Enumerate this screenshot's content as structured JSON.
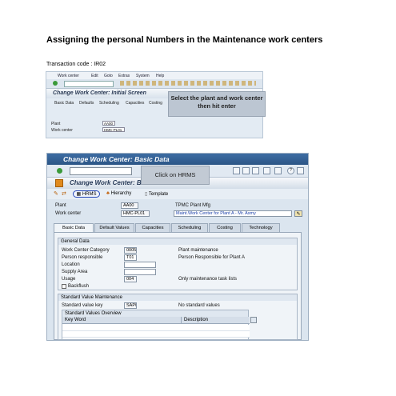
{
  "doc": {
    "title": "Assigning the personal Numbers in the Maintenance work centers",
    "tcode": "Transaction code : IR02"
  },
  "shot1": {
    "menu": [
      "Work center",
      "Edit",
      "Goto",
      "Extras",
      "System",
      "Help"
    ],
    "title": "Change Work Center: Initial Screen",
    "tabs": [
      "Basic Data",
      "Defaults",
      "Scheduling",
      "Capacities",
      "Costing"
    ],
    "plant_label": "Plant",
    "plant_value": "AA00",
    "wc_label": "Work center",
    "wc_value": "HMC-PL01",
    "callout": "Select the plant and work center then hit enter"
  },
  "shot2": {
    "window_title": "Change Work Center: Basic Data",
    "header_title": "Change Work Center: Basic Data",
    "callout": "Click on HRMS",
    "app_buttons": [
      "HRMS",
      "Hierarchy",
      "Template"
    ],
    "plant_label": "Plant",
    "plant_value": "AA00",
    "plant_desc": "TPMC Plant Mfg",
    "wc_label": "Work center",
    "wc_value": "HMC-PL01",
    "wc_desc": "Maint.Work Center for Plant A - Mr. Asmy",
    "tabs": [
      "Basic Data",
      "Default Values",
      "Capacities",
      "Scheduling",
      "Costing",
      "Technology"
    ],
    "general": {
      "title": "General Data",
      "category_label": "Work Center Category",
      "category_value": "0005",
      "category_desc": "Plant maintenance",
      "person_label": "Person responsible",
      "person_value": "T01",
      "person_desc": "Person Responsible for Plant A",
      "location_label": "Location",
      "supply_label": "Supply Area",
      "usage_label": "Usage",
      "usage_value": "004",
      "usage_desc": "Only maintenance task lists",
      "backflush_label": "Backflush"
    },
    "standard": {
      "title": "Standard Value Maintenance",
      "key_label": "Standard value key",
      "key_value": "SAP0",
      "key_desc": "No standard values",
      "overview_title": "Standard Values Overview",
      "col_keyword": "Key Word",
      "col_description": "Description"
    }
  },
  "colors": {
    "title_bar": "#2b5586",
    "hrms_highlight": "#2446b8"
  }
}
